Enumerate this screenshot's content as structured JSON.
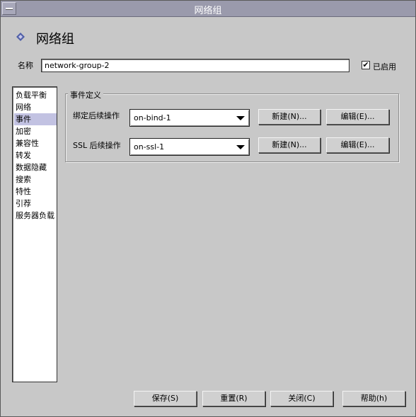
{
  "window": {
    "title": "网络组"
  },
  "header": {
    "title": "网络组",
    "icon": "diamond-icon"
  },
  "name_field": {
    "label": "名称",
    "value": "network-group-2"
  },
  "enabled": {
    "label": "已启用",
    "checked": true
  },
  "nav": {
    "items": [
      {
        "label": "负载平衡"
      },
      {
        "label": "网络"
      },
      {
        "label": "事件",
        "selected": true
      },
      {
        "label": "加密"
      },
      {
        "label": "兼容性"
      },
      {
        "label": "转发"
      },
      {
        "label": "数据隐藏"
      },
      {
        "label": "搜索"
      },
      {
        "label": "特性"
      },
      {
        "label": "引荐"
      },
      {
        "label": "服务器负载"
      }
    ]
  },
  "events": {
    "group_title": "事件定义",
    "rows": [
      {
        "label": "绑定后续操作",
        "value": "on-bind-1",
        "new_label": "新建(N)...",
        "edit_label": "编辑(E)..."
      },
      {
        "label": "SSL 后续操作",
        "value": "on-ssl-1",
        "new_label": "新建(N)...",
        "edit_label": "编辑(E)..."
      }
    ]
  },
  "footer": {
    "save": "保存(S)",
    "reset": "重置(R)",
    "close": "关闭(C)",
    "help": "帮助(h)"
  },
  "colors": {
    "background": "#c8c8c8",
    "titlebar": "#9a9aac",
    "selection": "#c2c2e2",
    "icon": "#5060a8"
  }
}
